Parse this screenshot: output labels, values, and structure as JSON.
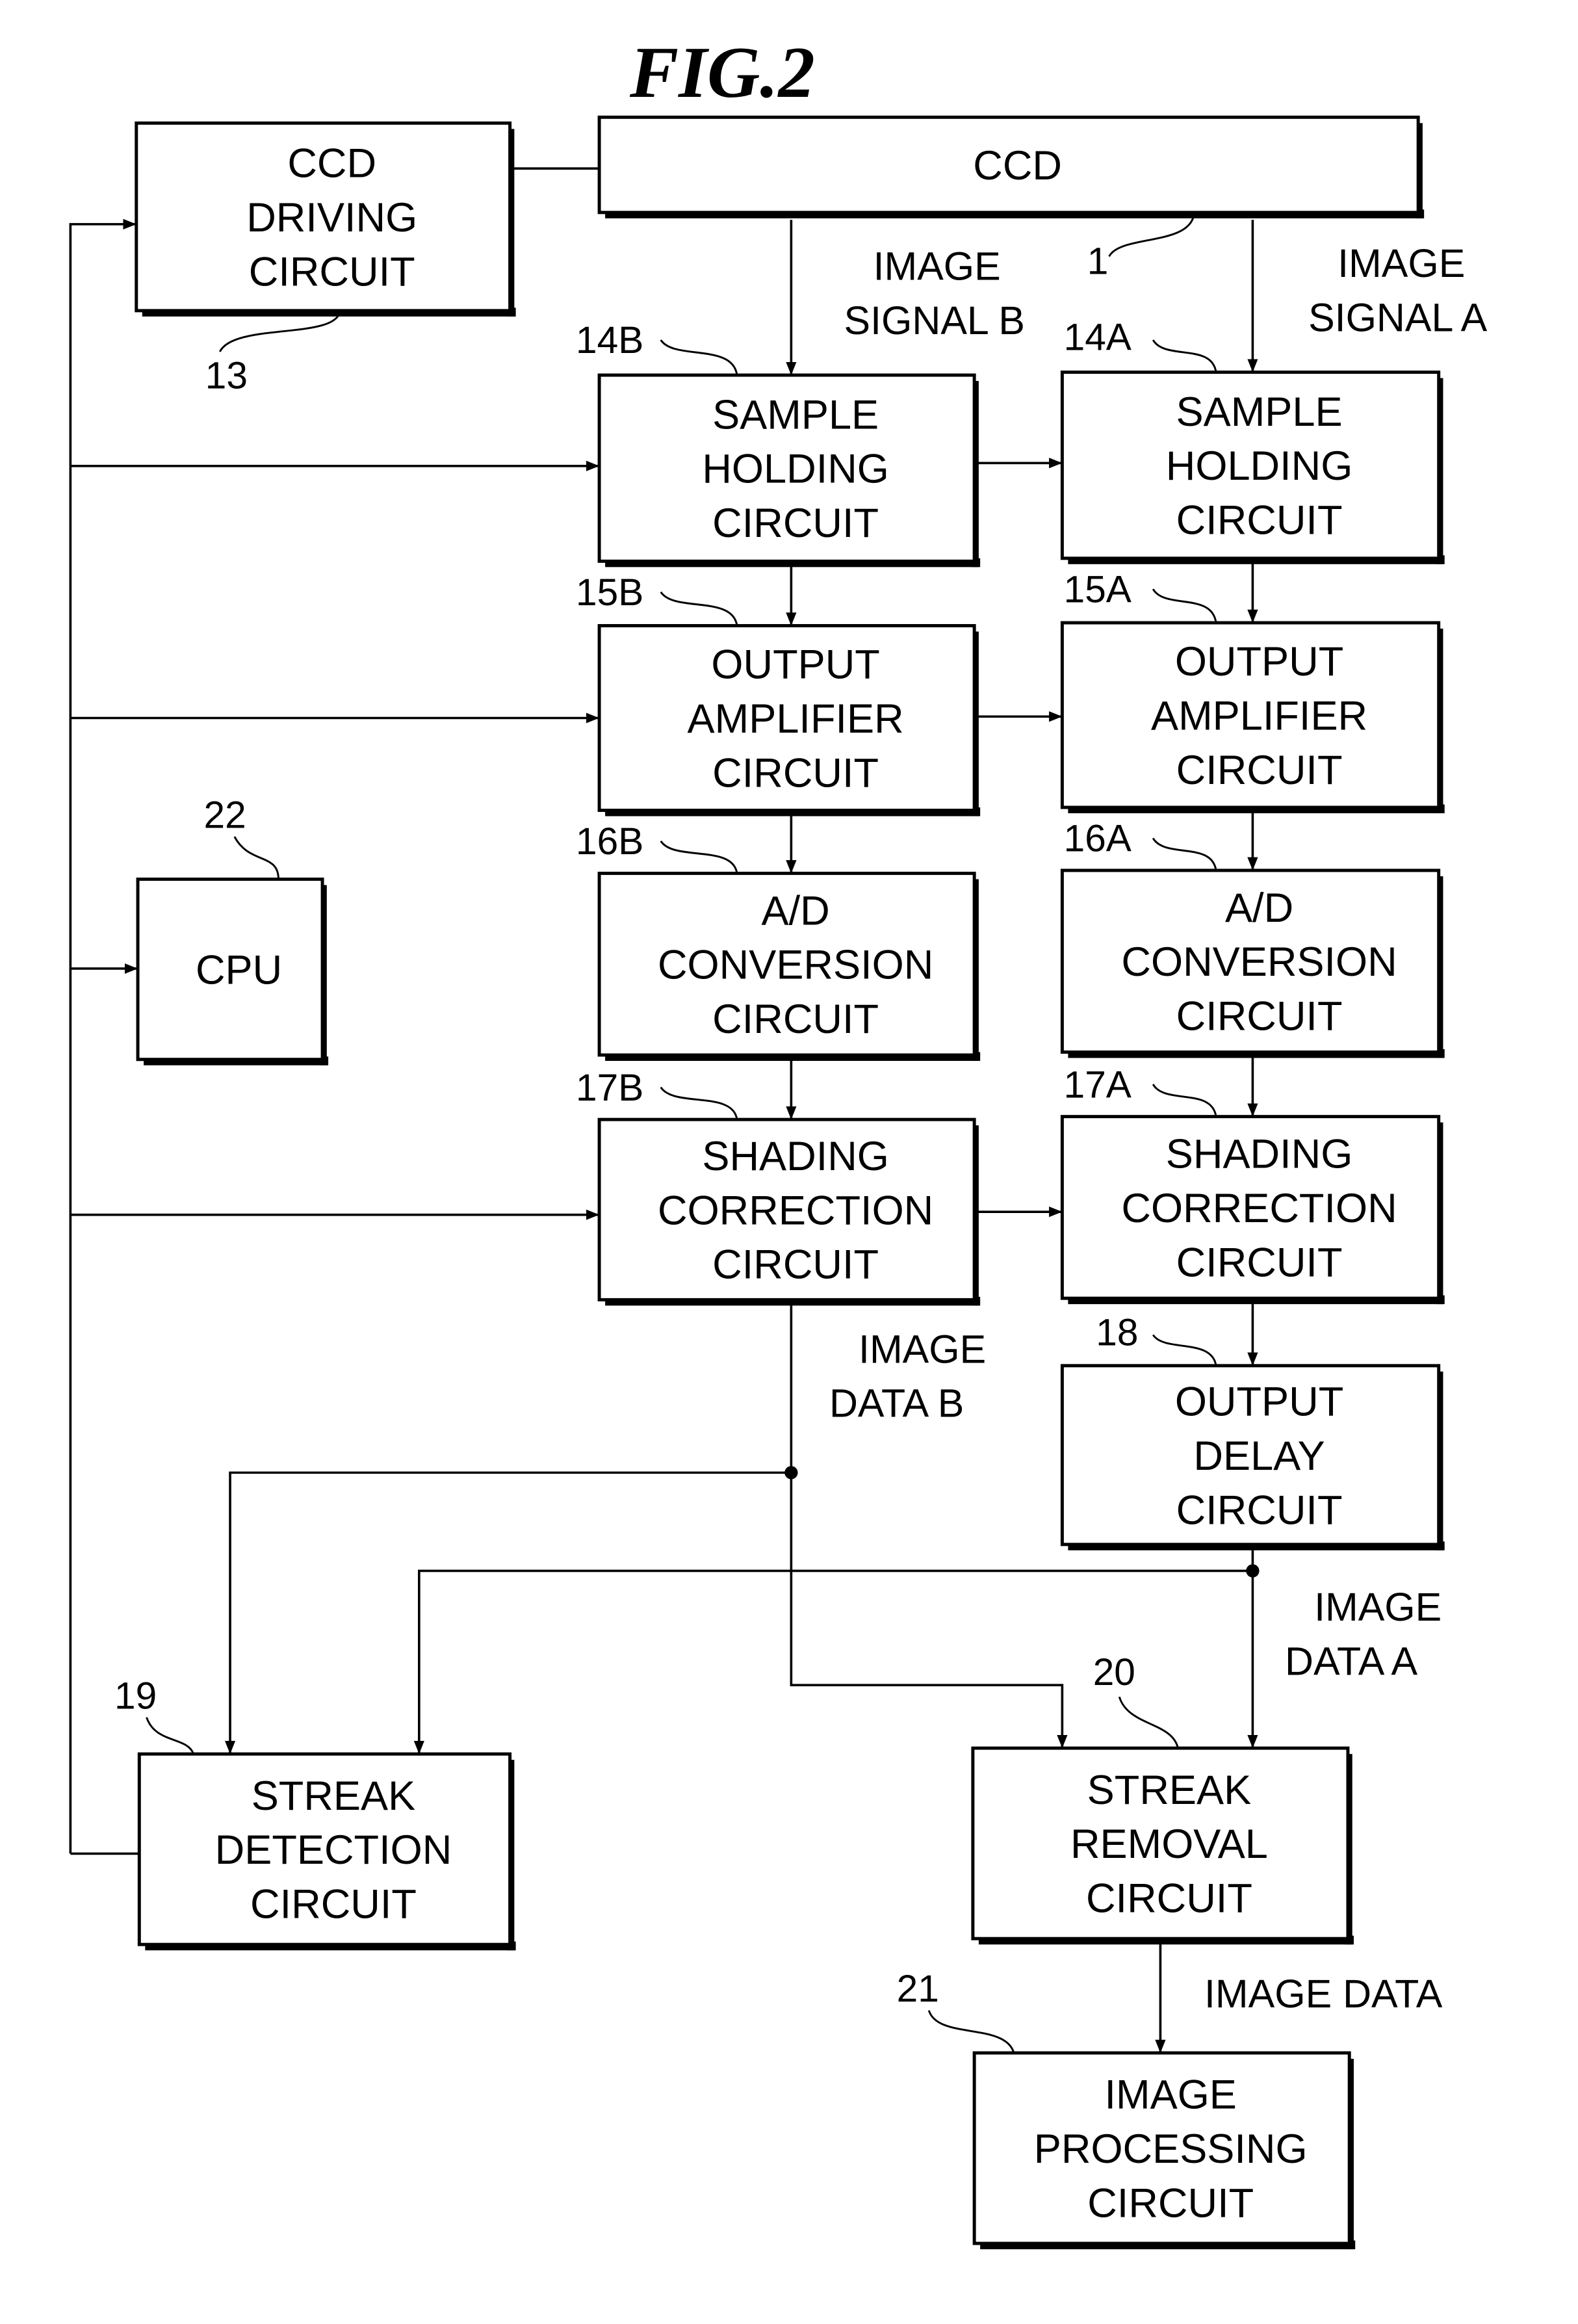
{
  "figure": {
    "title": "FIG.2"
  },
  "blocks": {
    "ccd_driving": {
      "ref": "13",
      "lines": [
        "CCD",
        "DRIVING",
        "CIRCUIT"
      ]
    },
    "ccd": {
      "ref": "1",
      "lines": [
        "CCD"
      ]
    },
    "sample_b": {
      "ref": "14B",
      "lines": [
        "SAMPLE",
        "HOLDING",
        "CIRCUIT"
      ]
    },
    "sample_a": {
      "ref": "14A",
      "lines": [
        "SAMPLE",
        "HOLDING",
        "CIRCUIT"
      ]
    },
    "output_amp_b": {
      "ref": "15B",
      "lines": [
        "OUTPUT",
        "AMPLIFIER",
        "CIRCUIT"
      ]
    },
    "output_amp_a": {
      "ref": "15A",
      "lines": [
        "OUTPUT",
        "AMPLIFIER",
        "CIRCUIT"
      ]
    },
    "cpu": {
      "ref": "22",
      "lines": [
        "CPU"
      ]
    },
    "ad_b": {
      "ref": "16B",
      "lines": [
        "A/D",
        "CONVERSION",
        "CIRCUIT"
      ]
    },
    "ad_a": {
      "ref": "16A",
      "lines": [
        "A/D",
        "CONVERSION",
        "CIRCUIT"
      ]
    },
    "shading_b": {
      "ref": "17B",
      "lines": [
        "SHADING",
        "CORRECTION",
        "CIRCUIT"
      ]
    },
    "shading_a": {
      "ref": "17A",
      "lines": [
        "SHADING",
        "CORRECTION",
        "CIRCUIT"
      ]
    },
    "output_delay": {
      "ref": "18",
      "lines": [
        "OUTPUT",
        "DELAY",
        "CIRCUIT"
      ]
    },
    "streak_detection": {
      "ref": "19",
      "lines": [
        "STREAK",
        "DETECTION",
        "CIRCUIT"
      ]
    },
    "streak_removal": {
      "ref": "20",
      "lines": [
        "STREAK",
        "REMOVAL",
        "CIRCUIT"
      ]
    },
    "image_processing": {
      "ref": "21",
      "lines": [
        "IMAGE",
        "PROCESSING",
        "CIRCUIT"
      ]
    }
  },
  "signals": {
    "image_signal_b": [
      "IMAGE",
      "SIGNAL B"
    ],
    "image_signal_a": [
      "IMAGE",
      "SIGNAL A"
    ],
    "image_data_b": [
      "IMAGE",
      "DATA B"
    ],
    "image_data_a": [
      "IMAGE",
      "DATA A"
    ],
    "image_data": [
      "IMAGE DATA"
    ]
  }
}
